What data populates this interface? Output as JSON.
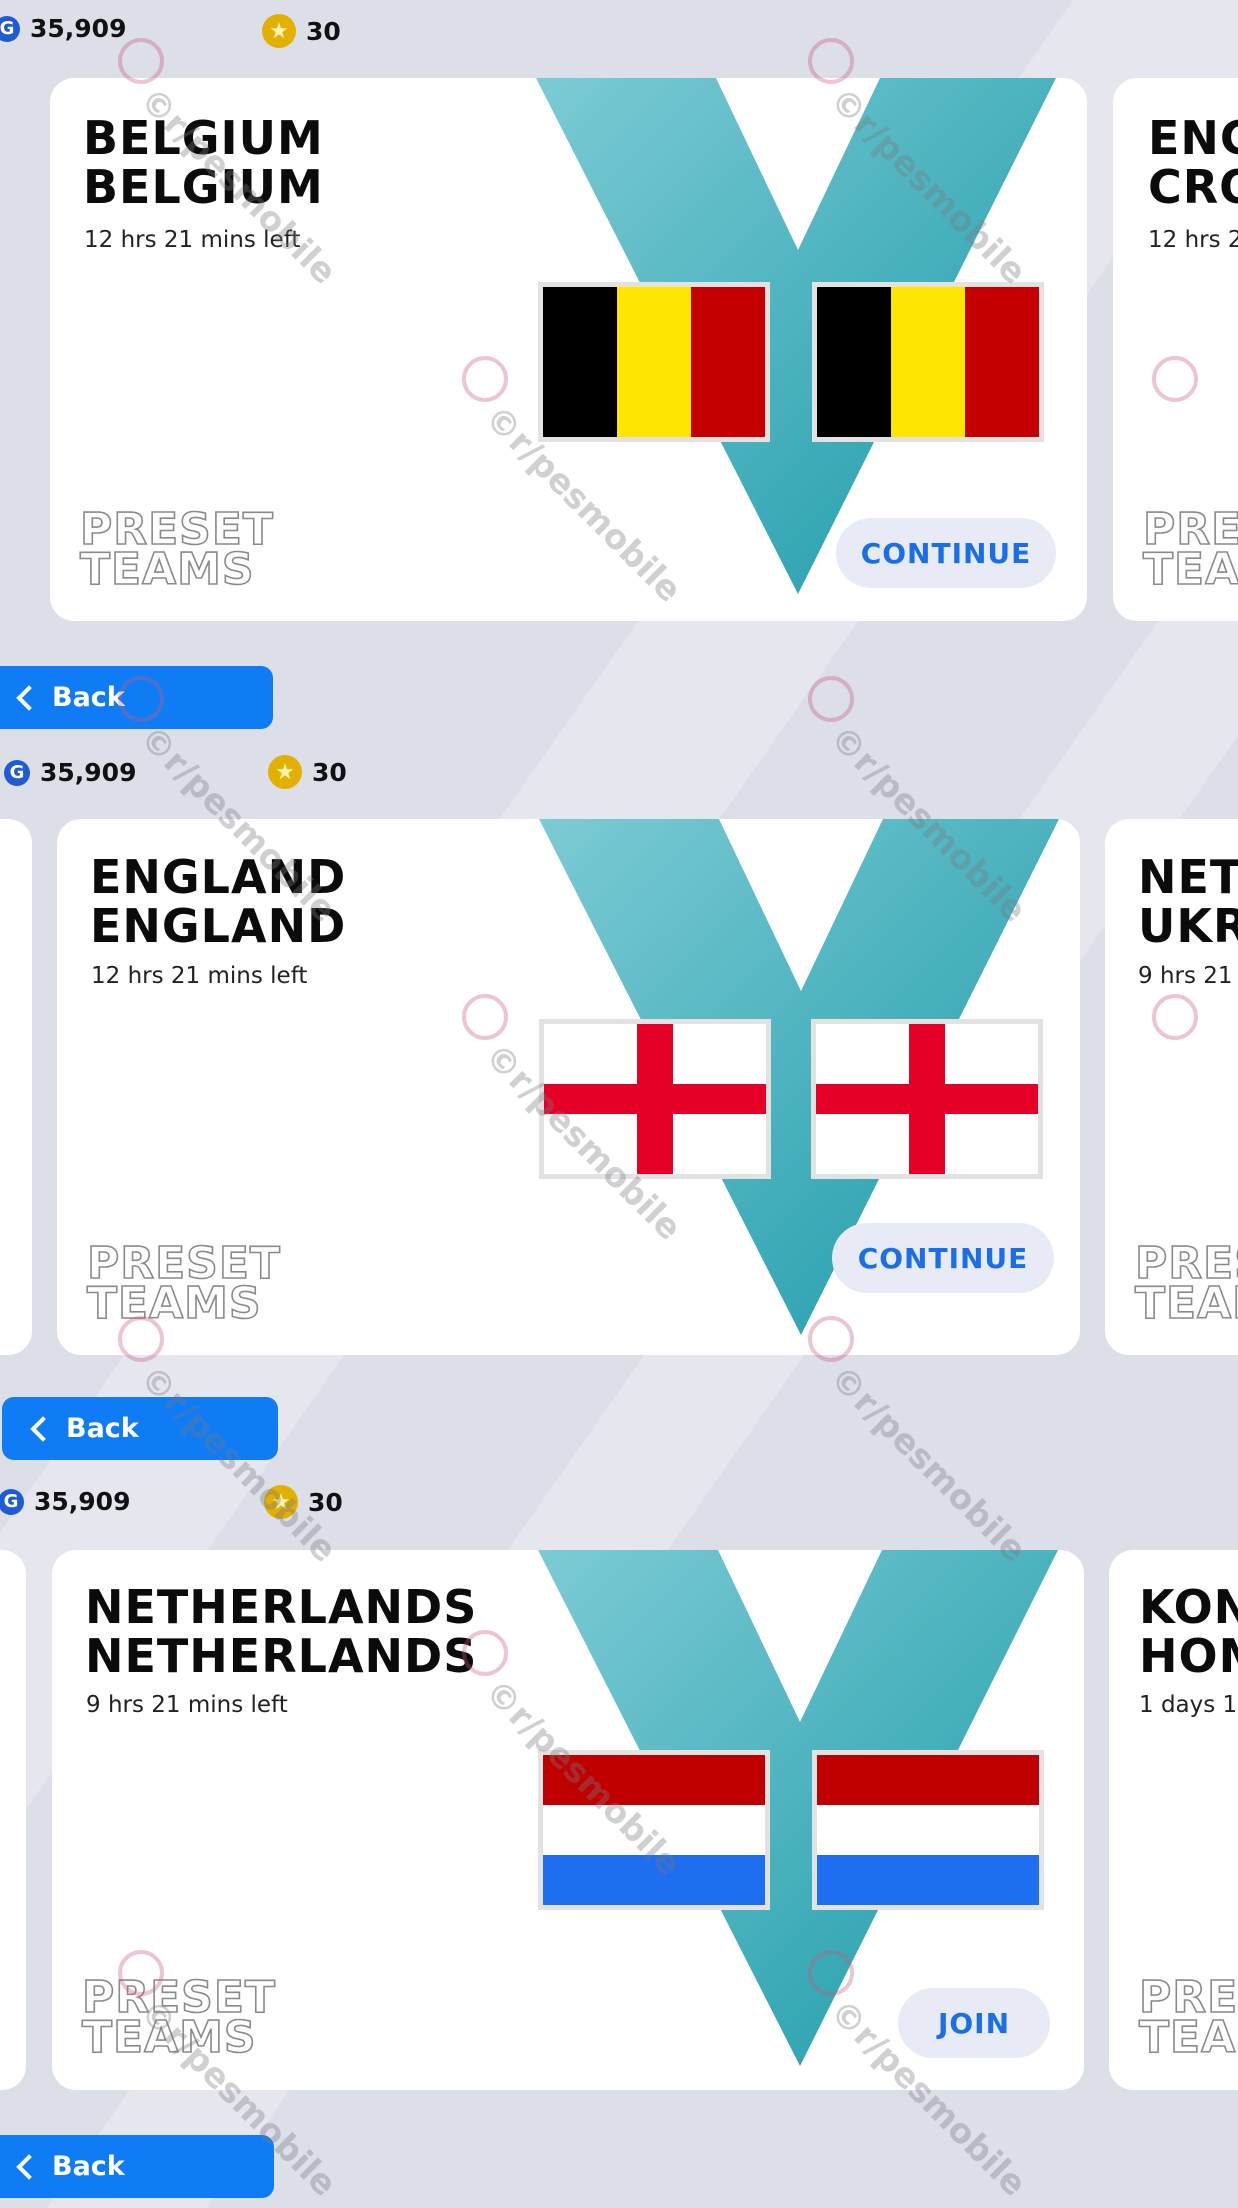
{
  "currency": {
    "gp": "35,909",
    "coins": "30",
    "gp_icon": "G"
  },
  "watermark": "©r/pesmobile",
  "panels": [
    {
      "title": "BELGIUM\nBELGIUM",
      "time_left": "12 hrs 21 mins left",
      "preset_line1": "PRESET",
      "preset_line2": "TEAMS",
      "action": "CONTINUE",
      "flag": "belgium",
      "next_card": {
        "title": "ENG\nCRO",
        "time": "12 hrs 2"
      }
    },
    {
      "title": "ENGLAND\nENGLAND",
      "time_left": "12 hrs 21 mins left",
      "preset_line1": "PRESET",
      "preset_line2": "TEAMS",
      "action": "CONTINUE",
      "flag": "england",
      "next_card": {
        "title": "NETI\nUKR/",
        "time": "9 hrs 21"
      }
    },
    {
      "title": "NETHERLANDS\nNETHERLANDS",
      "time_left": "9 hrs 21 mins left",
      "preset_line1": "PRESET",
      "preset_line2": "TEAMS",
      "action": "JOIN",
      "flag": "netherlands",
      "next_card": {
        "title": "KON\nHOM",
        "time": "1 days 1"
      }
    }
  ],
  "back_label": "Back",
  "colors": {
    "accent_blue": "#0f7cf6",
    "v_teal": "#2aa6b8",
    "button_text": "#1a6ee8"
  }
}
